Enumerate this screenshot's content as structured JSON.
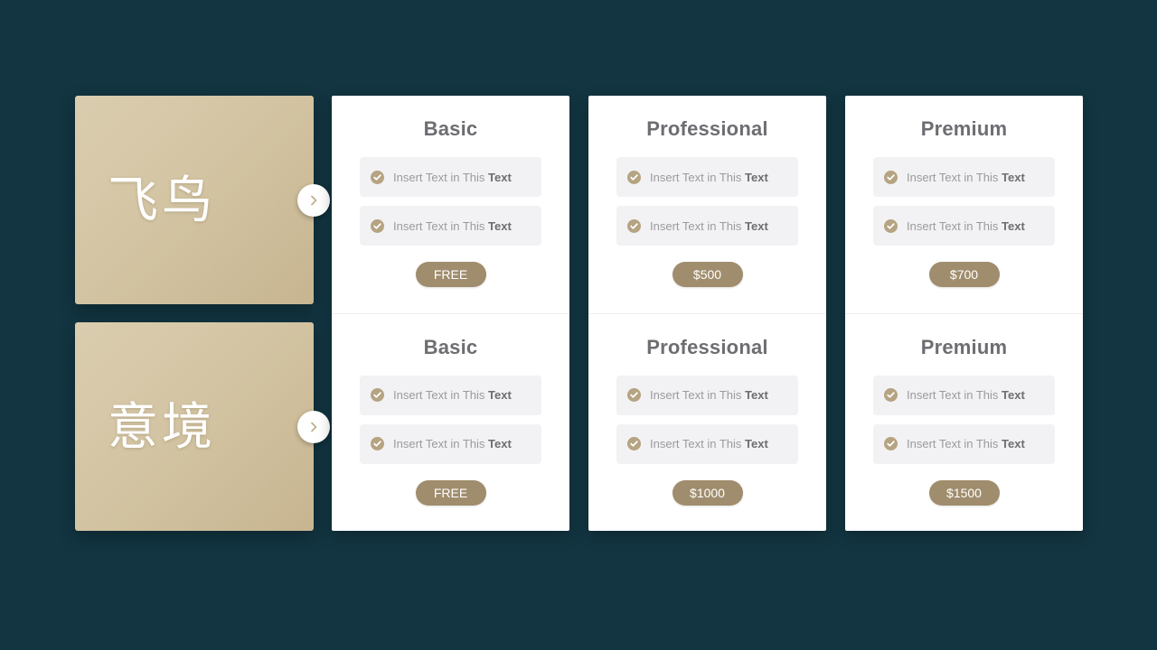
{
  "theme": {
    "background": "#123541",
    "tile_color": "#d3c4a3",
    "accent": "#a08d6d",
    "card_background": "#ffffff",
    "title_color": "#6d6d72",
    "feature_row_background": "#f2f2f4"
  },
  "tiles": [
    {
      "label": "飞鸟",
      "arrow_icon": "chevron-right-icon"
    },
    {
      "label": "意境",
      "arrow_icon": "chevron-right-icon"
    }
  ],
  "cards": [
    {
      "plans": [
        {
          "title": "Basic",
          "features": [
            {
              "icon": "check-circle-icon",
              "text": "Insert Text in This ",
              "bold": "Text"
            },
            {
              "icon": "check-circle-icon",
              "text": "Insert Text in This ",
              "bold": "Text"
            }
          ],
          "price": "FREE"
        },
        {
          "title": "Basic",
          "features": [
            {
              "icon": "check-circle-icon",
              "text": "Insert Text in This ",
              "bold": "Text"
            },
            {
              "icon": "check-circle-icon",
              "text": "Insert Text in This ",
              "bold": "Text"
            }
          ],
          "price": "FREE"
        }
      ]
    },
    {
      "plans": [
        {
          "title": "Professional",
          "features": [
            {
              "icon": "check-circle-icon",
              "text": "Insert Text in This ",
              "bold": "Text"
            },
            {
              "icon": "check-circle-icon",
              "text": "Insert Text in This ",
              "bold": "Text"
            }
          ],
          "price": "$500"
        },
        {
          "title": "Professional",
          "features": [
            {
              "icon": "check-circle-icon",
              "text": "Insert Text in This ",
              "bold": "Text"
            },
            {
              "icon": "check-circle-icon",
              "text": "Insert Text in This ",
              "bold": "Text"
            }
          ],
          "price": "$1000"
        }
      ]
    },
    {
      "plans": [
        {
          "title": "Premium",
          "features": [
            {
              "icon": "check-circle-icon",
              "text": "Insert Text in This ",
              "bold": "Text"
            },
            {
              "icon": "check-circle-icon",
              "text": "Insert Text in This ",
              "bold": "Text"
            }
          ],
          "price": "$700"
        },
        {
          "title": "Premium",
          "features": [
            {
              "icon": "check-circle-icon",
              "text": "Insert Text in This ",
              "bold": "Text"
            },
            {
              "icon": "check-circle-icon",
              "text": "Insert Text in This ",
              "bold": "Text"
            }
          ],
          "price": "$1500"
        }
      ]
    }
  ]
}
